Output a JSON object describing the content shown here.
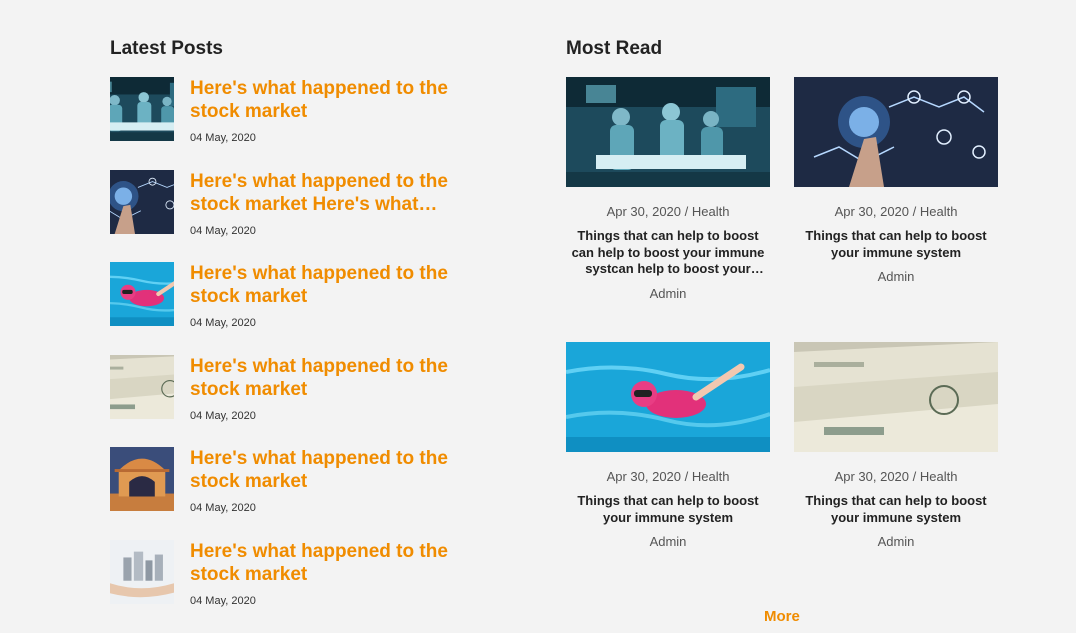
{
  "latest": {
    "heading": "Latest Posts",
    "posts": [
      {
        "title": "Here's what happened to the stock market",
        "date": "04 May, 2020",
        "image": "surgery-room"
      },
      {
        "title": "Here's what happened to the stock market Here's what happened to the stock market",
        "date": "04 May, 2020",
        "image": "digital-tech"
      },
      {
        "title": "Here's what happened to the stock market",
        "date": "04 May, 2020",
        "image": "swimmer"
      },
      {
        "title": "Here's what happened to the stock market",
        "date": "04 May, 2020",
        "image": "dollar-bills"
      },
      {
        "title": "Here's what happened to the stock market",
        "date": "04 May, 2020",
        "image": "temple"
      },
      {
        "title": "Here's what happened to the stock market",
        "date": "04 May, 2020",
        "image": "city-in-hand"
      }
    ]
  },
  "most_read": {
    "heading": "Most Read",
    "cards": [
      {
        "meta": "Apr 30, 2020 / Health",
        "title": "Things that can help to boost can help to boost your immune systcan help to boost your immune system",
        "author": "Admin",
        "image": "surgery-room"
      },
      {
        "meta": "Apr 30, 2020 / Health",
        "title": "Things that can help to boost your immune system",
        "author": "Admin",
        "image": "digital-tech"
      },
      {
        "meta": "Apr 30, 2020 / Health",
        "title": "Things that can help to boost your immune system",
        "author": "Admin",
        "image": "swimmer"
      },
      {
        "meta": "Apr 30, 2020 / Health",
        "title": "Things that can help to boost your immune system",
        "author": "Admin",
        "image": "dollar-bills"
      }
    ],
    "more_label": "More"
  },
  "colors": {
    "accent": "#f08c00",
    "background": "#f3f3f3",
    "text": "#222222"
  }
}
